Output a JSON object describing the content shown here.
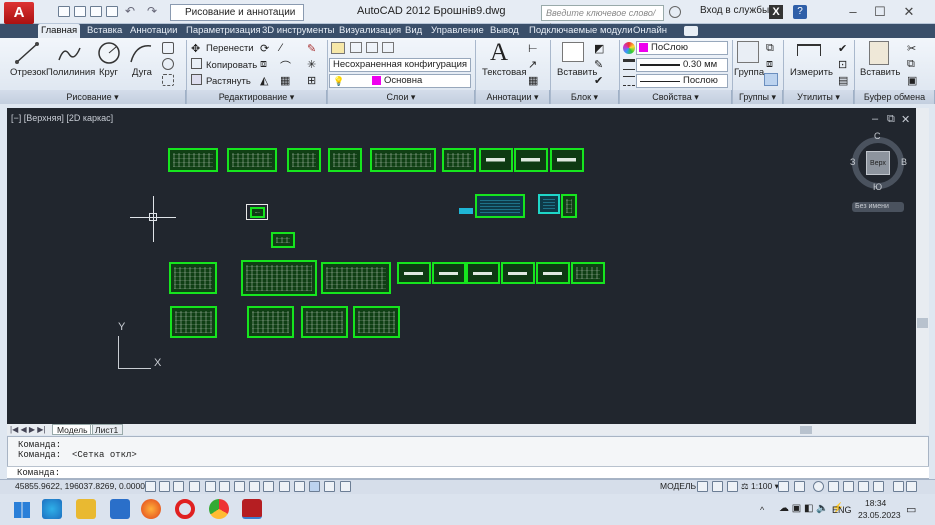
{
  "titlebar": {
    "app_logo": "A",
    "workspace": "Рисование и аннотации",
    "title": "AutoCAD 2012    Брошнів9.dwg",
    "search_placeholder": "Введите ключевое слово/фразу",
    "signin": "Вход в службы"
  },
  "tabs": [
    "Главная",
    "Вставка",
    "Аннотации",
    "Параметризация",
    "3D инструменты",
    "Визуализация",
    "Вид",
    "Управление",
    "Вывод",
    "Подключаемые модули",
    "Онлайн"
  ],
  "ribbon": {
    "draw": {
      "line": "Отрезок",
      "polyline": "Полилиния",
      "circle": "Круг",
      "arc": "Дуга",
      "panel": "Рисование"
    },
    "modify": {
      "move": "Перенести",
      "copy": "Копировать",
      "stretch": "Растянуть",
      "panel": "Редактирование"
    },
    "layers": {
      "state": "Несохраненная конфигурация сло",
      "layer": "Основна",
      "panel": "Слои"
    },
    "annotation": {
      "text": "Текстовая",
      "panel": "Аннотации"
    },
    "block": {
      "insert": "Вставить",
      "panel": "Блок"
    },
    "properties": {
      "color": "ПоСлою",
      "lineweight": "0.30 мм",
      "linetype": "Послою",
      "panel": "Свойства"
    },
    "groups": {
      "group": "Группа",
      "panel": "Группы"
    },
    "utilities": {
      "measure": "Измерить",
      "panel": "Утилиты"
    },
    "clipboard": {
      "paste": "Вставить",
      "panel": "Буфер обмена"
    }
  },
  "viewport": {
    "label": "[−] [Верхняя] [2D каркас]",
    "viewcube": {
      "top": "Верх",
      "n": "С",
      "s": "Ю",
      "w": "З",
      "e": "В",
      "ucs": "Без имени"
    },
    "ucs_x": "X",
    "ucs_y": "Y"
  },
  "layout_tabs": [
    "Модель",
    "Лист1"
  ],
  "command": {
    "line1": "Команда:",
    "line2": "Команда:  <Сетка откл>",
    "prompt": "Команда:"
  },
  "status": {
    "coords": "45855.9622,  196037.8269, 0.0000",
    "model": "МОДЕЛЬ",
    "scale": "1:100"
  },
  "taskbar": {
    "lang": "ENG",
    "time": "18:34",
    "date": "23.05.2023"
  },
  "colors": {
    "sheet_green": "#16e51e",
    "canvas": "#21262e",
    "accent": "#3a4f6a"
  }
}
